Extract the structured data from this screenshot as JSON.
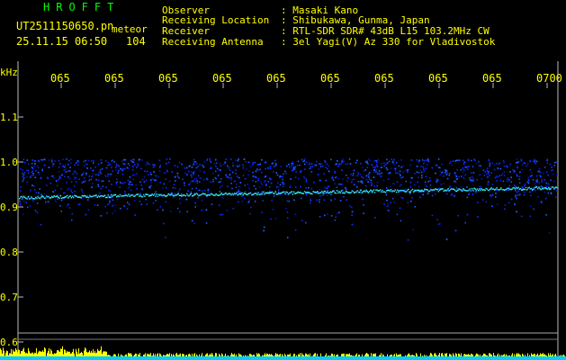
{
  "header": {
    "station": "HROFFT",
    "filename": "UT2511150650.pn",
    "type_label": "meteor",
    "datetime": "25.11.15 06:50",
    "count": "104",
    "observer_label": "Observer",
    "observer_value": ": Masaki Kano",
    "location_label": "Receiving Location",
    "location_value": ": Shibukawa, Gunma, Japan",
    "receiver_label": "Receiver",
    "receiver_value": ": RTL-SDR SDR# 43dB L15 103.2MHz CW",
    "antenna_label": "Receiving Antenna",
    "antenna_value": ": 3el Yagi(V) Az 330 for Vladivostok"
  },
  "axis": {
    "unit": "kHz",
    "y_ticks": [
      "1.1",
      "1.0",
      "0.9",
      "0.8",
      "0.7",
      "0.6"
    ],
    "x_ticks": [
      "065",
      "065",
      "065",
      "065",
      "065",
      "065",
      "065",
      "065",
      "065",
      "0700"
    ]
  },
  "colors": {
    "background": "#000000",
    "header_green": "#00ff00",
    "header_yellow": "#ffff00",
    "signal_blue": "#0a2aff",
    "signal_cyan": "#33ffee",
    "histogram_cyan": "#00ccff"
  }
}
